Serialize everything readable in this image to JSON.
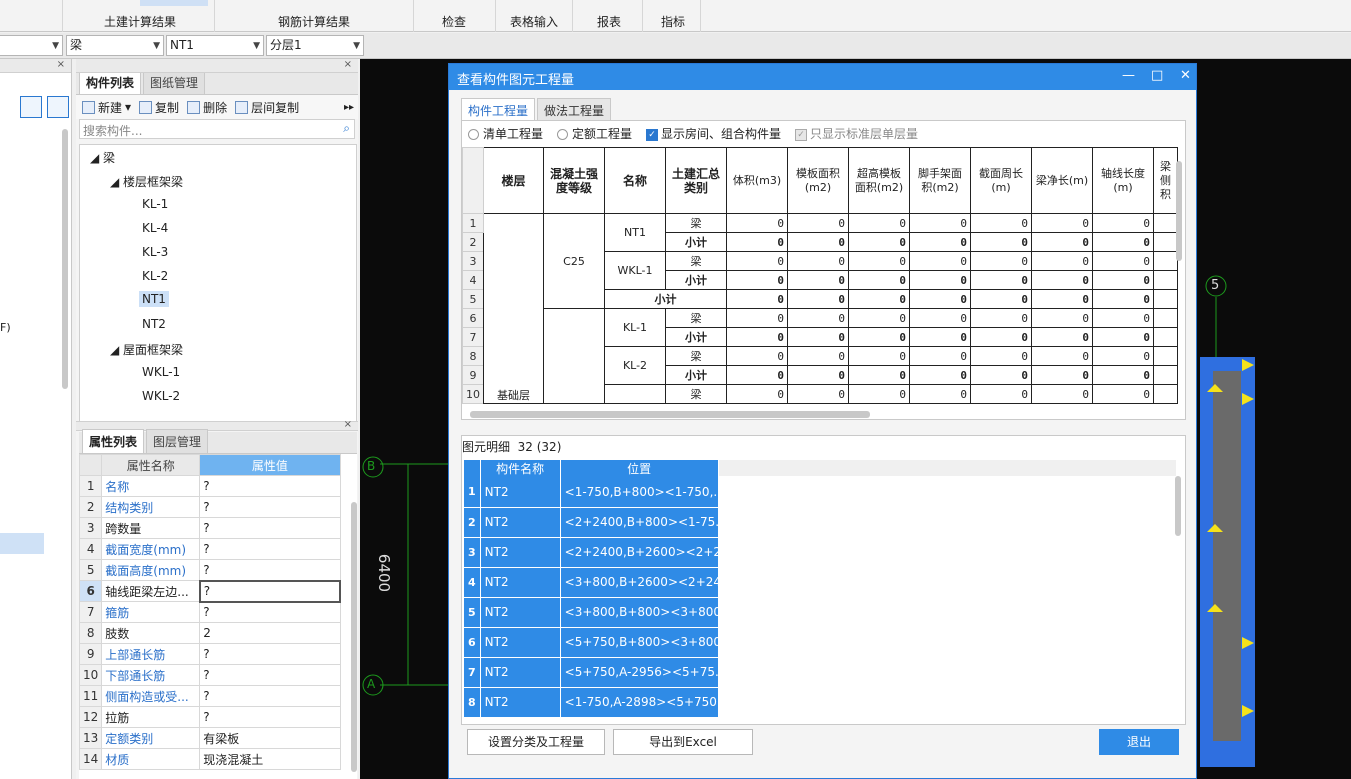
{
  "ribbon": {
    "tabs": [
      "土建计算结果",
      "钢筋计算结果",
      "检查",
      "表格输入",
      "报表",
      "指标"
    ]
  },
  "combos": {
    "c1": "",
    "c2": "梁",
    "c3": "NT1",
    "c4": "分层1"
  },
  "left_stub": "F)",
  "component_panel": {
    "tabs": [
      "构件列表",
      "图纸管理"
    ],
    "toolbar": {
      "new": "新建",
      "copy": "复制",
      "delete": "删除",
      "copy_floor": "层间复制"
    },
    "search_placeholder": "搜索构件...",
    "tree": {
      "root": "梁",
      "group1": "楼层框架梁",
      "g1_items": [
        "KL-1",
        "KL-4",
        "KL-3",
        "KL-2",
        "NT1",
        "NT2"
      ],
      "group2": "屋面框架梁",
      "g2_items": [
        "WKL-1",
        "WKL-2"
      ]
    }
  },
  "property_panel": {
    "tabs": [
      "属性列表",
      "图层管理"
    ],
    "header": {
      "name": "属性名称",
      "value": "属性值"
    },
    "rows": [
      {
        "n": "1",
        "k": "名称",
        "v": "?"
      },
      {
        "n": "2",
        "k": "结构类别",
        "v": "?"
      },
      {
        "n": "3",
        "k": "跨数量",
        "v": "?"
      },
      {
        "n": "4",
        "k": "截面宽度(mm)",
        "v": "?"
      },
      {
        "n": "5",
        "k": "截面高度(mm)",
        "v": "?"
      },
      {
        "n": "6",
        "k": "轴线距梁左边...",
        "v": "?"
      },
      {
        "n": "7",
        "k": "箍筋",
        "v": "?"
      },
      {
        "n": "8",
        "k": "肢数",
        "v": "2"
      },
      {
        "n": "9",
        "k": "上部通长筋",
        "v": "?"
      },
      {
        "n": "10",
        "k": "下部通长筋",
        "v": "?"
      },
      {
        "n": "11",
        "k": "侧面构造或受...",
        "v": "?"
      },
      {
        "n": "12",
        "k": "拉筋",
        "v": "?"
      },
      {
        "n": "13",
        "k": "定额类别",
        "v": "有梁板"
      },
      {
        "n": "14",
        "k": "材质",
        "v": "现浇混凝土"
      }
    ]
  },
  "canvas": {
    "axis_b": "B",
    "axis_a": "A",
    "axis_5": "5",
    "dim": "6400"
  },
  "dialog": {
    "title": "查看构件图元工程量",
    "tabs": [
      "构件工程量",
      "做法工程量"
    ],
    "options": {
      "bill": "清单工程量",
      "quota": "定额工程量",
      "show_rooms": "显示房间、组合构件量",
      "std_only": "只显示标准层单层量"
    },
    "table": {
      "headers": [
        "楼层",
        "混凝土强度等级",
        "名称",
        "土建汇总类别",
        "体积(m3)",
        "模板面积(m2)",
        "超高模板面积(m2)",
        "脚手架面积(m2)",
        "截面周长(m)",
        "梁净长(m)",
        "轴线长度(m)",
        "梁侧积"
      ],
      "floor": "基础层",
      "grade": "C25",
      "rows": [
        {
          "n": "1",
          "name": "NT1",
          "cat": "梁",
          "vals": [
            "0",
            "0",
            "0",
            "0",
            "0",
            "0",
            "0"
          ]
        },
        {
          "n": "2",
          "name": "",
          "cat": "小计",
          "vals": [
            "0",
            "0",
            "0",
            "0",
            "0",
            "0",
            "0"
          ]
        },
        {
          "n": "3",
          "name": "WKL-1",
          "cat": "梁",
          "vals": [
            "0",
            "0",
            "0",
            "0",
            "0",
            "0",
            "0"
          ]
        },
        {
          "n": "4",
          "name": "",
          "cat": "小计",
          "vals": [
            "0",
            "0",
            "0",
            "0",
            "0",
            "0",
            "0"
          ]
        },
        {
          "n": "5",
          "name": "小计",
          "cat": "",
          "vals": [
            "0",
            "0",
            "0",
            "0",
            "0",
            "0",
            "0"
          ]
        },
        {
          "n": "6",
          "name": "KL-1",
          "cat": "梁",
          "vals": [
            "0",
            "0",
            "0",
            "0",
            "0",
            "0",
            "0"
          ]
        },
        {
          "n": "7",
          "name": "",
          "cat": "小计",
          "vals": [
            "0",
            "0",
            "0",
            "0",
            "0",
            "0",
            "0"
          ]
        },
        {
          "n": "8",
          "name": "KL-2",
          "cat": "梁",
          "vals": [
            "0",
            "0",
            "0",
            "0",
            "0",
            "0",
            "0"
          ]
        },
        {
          "n": "9",
          "name": "",
          "cat": "小计",
          "vals": [
            "0",
            "0",
            "0",
            "0",
            "0",
            "0",
            "0"
          ]
        },
        {
          "n": "10",
          "name": "",
          "cat": "梁",
          "vals": [
            "0",
            "0",
            "0",
            "0",
            "0",
            "0",
            "0"
          ]
        }
      ]
    },
    "detail": {
      "label": "图元明细",
      "count": "32 (32)",
      "headers": [
        "构件名称",
        "位置"
      ],
      "rows": [
        {
          "n": "1",
          "name": "NT2",
          "pos": "<1-750,B+800><1-750,..."
        },
        {
          "n": "2",
          "name": "NT2",
          "pos": "<2+2400,B+800><1-75..."
        },
        {
          "n": "3",
          "name": "NT2",
          "pos": "<2+2400,B+2600><2+2..."
        },
        {
          "n": "4",
          "name": "NT2",
          "pos": "<3+800,B+2600><2+24..."
        },
        {
          "n": "5",
          "name": "NT2",
          "pos": "<3+800,B+800><3+800..."
        },
        {
          "n": "6",
          "name": "NT2",
          "pos": "<5+750,B+800><3+800..."
        },
        {
          "n": "7",
          "name": "NT2",
          "pos": "<5+750,A-2956><5+75..."
        },
        {
          "n": "8",
          "name": "NT2",
          "pos": "<1-750,A-2898><5+750..."
        }
      ]
    },
    "buttons": {
      "set": "设置分类及工程量",
      "export": "导出到Excel",
      "exit": "退出"
    }
  },
  "colors": {
    "accent": "#2f8be6",
    "link": "#2a6fc9",
    "canvas": "#0b0b0b"
  }
}
